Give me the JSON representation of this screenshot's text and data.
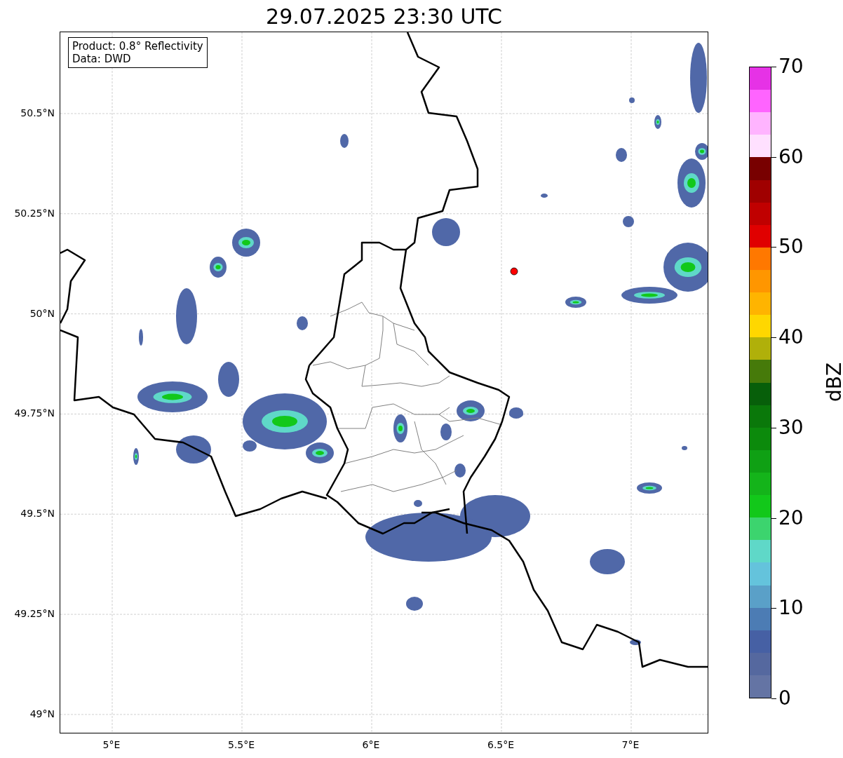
{
  "title": "29.07.2025 23:30 UTC",
  "info_box": {
    "lines": [
      "Product: 0.8° Reflectivity",
      "Data: DWD"
    ]
  },
  "map": {
    "xticks": [
      "5°E",
      "5.5°E",
      "6°E",
      "6.5°E",
      "7°E"
    ],
    "yticks": [
      "50.5°N",
      "50.25°N",
      "50°N",
      "49.75°N",
      "49.5°N",
      "49.25°N",
      "49°N"
    ]
  },
  "colorbar": {
    "label": "dBZ",
    "ticks": [
      "70",
      "60",
      "50",
      "40",
      "30",
      "20",
      "10",
      "0"
    ],
    "segments": [
      {
        "color": "#e632e6"
      },
      {
        "color": "#ff64ff"
      },
      {
        "color": "#ffb4ff"
      },
      {
        "color": "#ffe0ff"
      },
      {
        "color": "#780000"
      },
      {
        "color": "#a00000"
      },
      {
        "color": "#c00000"
      },
      {
        "color": "#e00000"
      },
      {
        "color": "#ff7800"
      },
      {
        "color": "#ff9600"
      },
      {
        "color": "#ffb400"
      },
      {
        "color": "#ffd700"
      },
      {
        "color": "#b0b00a"
      },
      {
        "color": "#467a0a"
      },
      {
        "color": "#075f0a"
      },
      {
        "color": "#0a780a"
      },
      {
        "color": "#0c8a0c"
      },
      {
        "color": "#0fa014"
      },
      {
        "color": "#14b41a"
      },
      {
        "color": "#12c81a"
      },
      {
        "color": "#3cd46e"
      },
      {
        "color": "#5fd8c8"
      },
      {
        "color": "#64c3dc"
      },
      {
        "color": "#5aa0c8"
      },
      {
        "color": "#4c7cb4"
      },
      {
        "color": "#4660a4"
      },
      {
        "color": "#55689f"
      },
      {
        "color": "#6474a4"
      }
    ]
  }
}
